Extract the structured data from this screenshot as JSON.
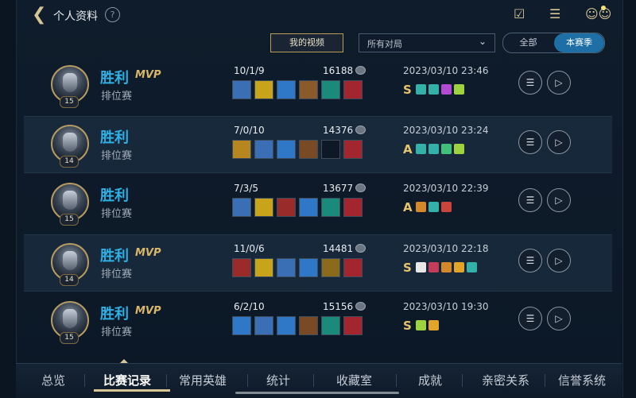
{
  "header": {
    "title": "个人资料",
    "help": "?"
  },
  "controls": {
    "video_btn": "我的视频",
    "filter_value": "所有对局",
    "season_toggle": [
      "全部",
      "本赛季"
    ]
  },
  "matches": [
    {
      "result": "胜利",
      "mvp": "MVP",
      "mode": "排位赛",
      "level": "15",
      "kda": "10/1/9",
      "score": "16188",
      "date": "2023/03/10 23:46",
      "grade": "S",
      "items": [
        "#3b6fb5",
        "#c7a41a",
        "#2f78c8",
        "#8a5a2b",
        "#1a8b7a",
        "#a3262e"
      ],
      "badges": [
        "#33b0a8",
        "#33b0a8",
        "#b24bd1",
        "#9fd23f"
      ]
    },
    {
      "result": "胜利",
      "mvp": "",
      "mode": "排位赛",
      "level": "14",
      "kda": "7/0/10",
      "score": "14376",
      "date": "2023/03/10 23:24",
      "grade": "A",
      "items": [
        "#b8861f",
        "#3b6fb5",
        "#2f78c8",
        "#7a4a25",
        "#0f1826",
        "#a3262e"
      ],
      "badges": [
        "#33b0a8",
        "#33b0a8",
        "#41c07a",
        "#9fd23f"
      ]
    },
    {
      "result": "胜利",
      "mvp": "",
      "mode": "排位赛",
      "level": "15",
      "kda": "7/3/5",
      "score": "13677",
      "date": "2023/03/10 22:39",
      "grade": "A",
      "items": [
        "#3b6fb5",
        "#c7a41a",
        "#9a2b2b",
        "#2f78c8",
        "#1a8b7a",
        "#a3262e"
      ],
      "badges": [
        "#d4882a",
        "#33b0a8",
        "#c9453c"
      ]
    },
    {
      "result": "胜利",
      "mvp": "MVP",
      "mode": "排位赛",
      "level": "14",
      "kda": "11/0/6",
      "score": "14481",
      "date": "2023/03/10 22:18",
      "grade": "S",
      "items": [
        "#9a2b2b",
        "#c7a41a",
        "#3b6fb5",
        "#2f78c8",
        "#8a6a1b",
        "#a3262e"
      ],
      "badges": [
        "#e7e7e7",
        "#c43c5a",
        "#d4882a",
        "#e2a52a",
        "#33b0a8"
      ]
    },
    {
      "result": "胜利",
      "mvp": "MVP",
      "mode": "排位赛",
      "level": "15",
      "kda": "6/2/10",
      "score": "15156",
      "date": "2023/03/10 19:30",
      "grade": "S",
      "items": [
        "#2f78c8",
        "#3b6fb5",
        "#2f78c8",
        "#7a4a25",
        "#1a8b7a",
        "#a3262e"
      ],
      "badges": [
        "#9fd23f",
        "#e2a52a"
      ]
    }
  ],
  "nav": [
    "总览",
    "比赛记录",
    "常用英雄",
    "统计",
    "收藏室",
    "成就",
    "亲密关系",
    "信誉系统"
  ],
  "nav_active": "比赛记录"
}
